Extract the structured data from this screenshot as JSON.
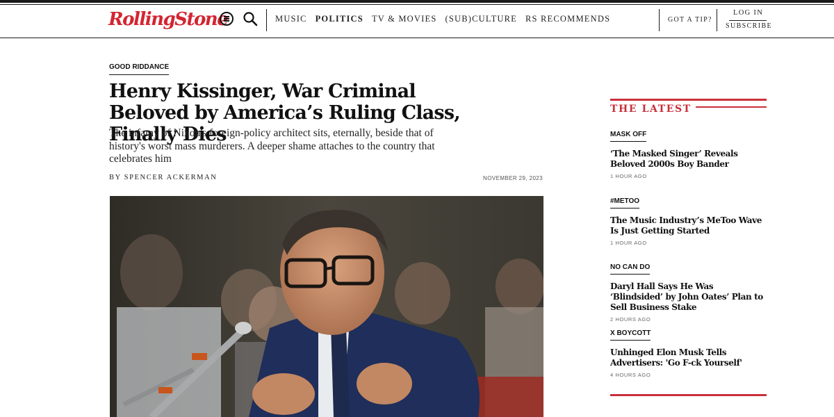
{
  "header": {
    "logo": "RollingStone",
    "nav": [
      "MUSIC",
      "POLITICS",
      "TV & MOVIES",
      "(SUB)CULTURE",
      "RS RECOMMENDS"
    ],
    "active_nav": "POLITICS",
    "tip": "GOT A TIP?",
    "login": "LOG IN",
    "subscribe": "SUBSCRIBE",
    "icons": [
      "menu-icon",
      "search-icon"
    ]
  },
  "article": {
    "kicker": "GOOD RIDDANCE",
    "headline": "Henry Kissinger, War Criminal Beloved by America’s Ruling Class, Finally Dies",
    "dek": "The infamy of Nixon's foreign-policy architect sits, eternally, beside that of history's worst mass murderers. A deeper shame attaches to the country that celebrates him",
    "byline_prefix": "BY",
    "author": "SPENCER ACKERMAN",
    "date": "NOVEMBER 29, 2023"
  },
  "sidebar": {
    "title": "THE LATEST",
    "items": [
      {
        "tag": "MASK OFF",
        "headline": "‘The Masked Singer’ Reveals Beloved 2000s Boy Bander",
        "time": "1 HOUR AGO"
      },
      {
        "tag": "#METOO",
        "headline": "The Music Industry’s MeToo Wave Is Just Getting Started",
        "time": "1 HOUR AGO"
      },
      {
        "tag": "NO CAN DO",
        "headline": "Daryl Hall Says He Was ‘Blindsided’ by John Oates’ Plan to Sell Business Stake",
        "time": "2 HOURS AGO"
      },
      {
        "tag": "X BOYCOTT",
        "headline": "Unhinged Elon Musk Tells Advertisers: 'Go F-ck Yourself'",
        "time": "4 HOURS AGO"
      }
    ]
  },
  "colors": {
    "brand_red": "#d32531",
    "sidebar_red": "#c9303a"
  }
}
